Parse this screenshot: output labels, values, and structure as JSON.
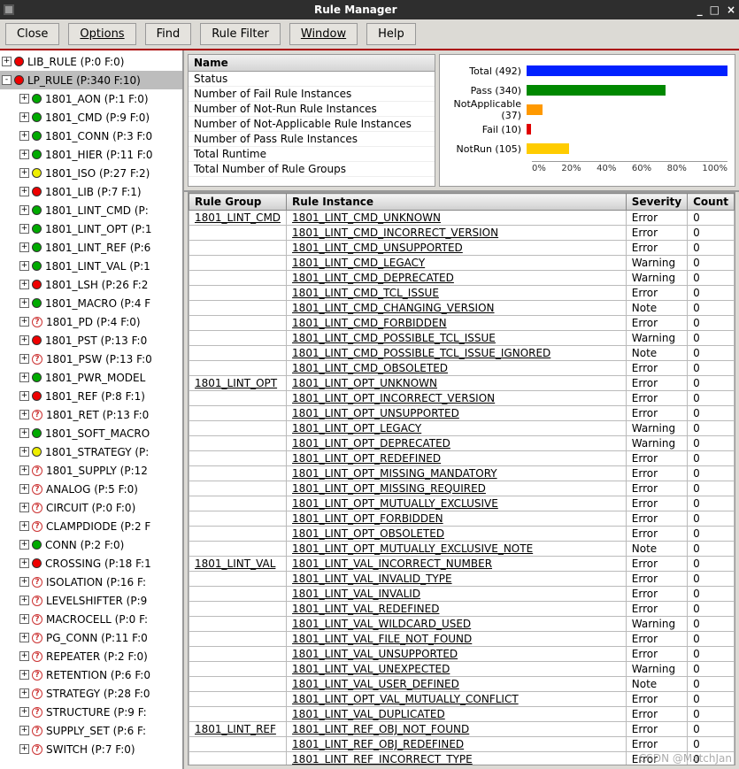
{
  "window": {
    "title": "Rule Manager",
    "min": "_",
    "max": "□",
    "close": "×"
  },
  "menu": {
    "close": "Close",
    "options": "Options",
    "find": "Find",
    "rule_filter": "Rule Filter",
    "window": "Window",
    "help": "Help"
  },
  "tree": [
    {
      "lvl": 0,
      "dot": "red",
      "label": "LIB_RULE",
      "info": "(P:0 F:0)",
      "sel": false,
      "exp": "+"
    },
    {
      "lvl": 0,
      "dot": "red",
      "label": "LP_RULE",
      "info": "(P:340 F:10)",
      "sel": true,
      "exp": "-"
    },
    {
      "lvl": 1,
      "dot": "green",
      "label": "1801_AON",
      "info": "(P:1 F:0)",
      "exp": "+"
    },
    {
      "lvl": 1,
      "dot": "green",
      "label": "1801_CMD",
      "info": "(P:9 F:0)",
      "exp": "+"
    },
    {
      "lvl": 1,
      "dot": "green",
      "label": "1801_CONN",
      "info": "(P:3 F:0",
      "exp": "+"
    },
    {
      "lvl": 1,
      "dot": "green",
      "label": "1801_HIER",
      "info": "(P:11 F:0",
      "exp": "+"
    },
    {
      "lvl": 1,
      "dot": "yellow",
      "label": "1801_ISO",
      "info": "(P:27 F:2)",
      "exp": "+"
    },
    {
      "lvl": 1,
      "dot": "red",
      "label": "1801_LIB",
      "info": "(P:7 F:1)",
      "exp": "+"
    },
    {
      "lvl": 1,
      "dot": "green",
      "label": "1801_LINT_CMD",
      "info": "(P:",
      "exp": "+"
    },
    {
      "lvl": 1,
      "dot": "green",
      "label": "1801_LINT_OPT",
      "info": "(P:1",
      "exp": "+"
    },
    {
      "lvl": 1,
      "dot": "green",
      "label": "1801_LINT_REF",
      "info": "(P:6",
      "exp": "+"
    },
    {
      "lvl": 1,
      "dot": "green",
      "label": "1801_LINT_VAL",
      "info": "(P:1",
      "exp": "+"
    },
    {
      "lvl": 1,
      "dot": "red",
      "label": "1801_LSH",
      "info": "(P:26 F:2",
      "exp": "+"
    },
    {
      "lvl": 1,
      "dot": "green",
      "label": "1801_MACRO",
      "info": "(P:4 F",
      "exp": "+"
    },
    {
      "lvl": 1,
      "dot": "q",
      "label": "1801_PD",
      "info": "(P:4 F:0)",
      "exp": "+"
    },
    {
      "lvl": 1,
      "dot": "red",
      "label": "1801_PST",
      "info": "(P:13 F:0",
      "exp": "+"
    },
    {
      "lvl": 1,
      "dot": "q",
      "label": "1801_PSW",
      "info": "(P:13 F:0",
      "exp": "+"
    },
    {
      "lvl": 1,
      "dot": "green",
      "label": "1801_PWR_MODEL",
      "info": "",
      "exp": "+"
    },
    {
      "lvl": 1,
      "dot": "red",
      "label": "1801_REF",
      "info": "(P:8 F:1)",
      "exp": "+"
    },
    {
      "lvl": 1,
      "dot": "q",
      "label": "1801_RET",
      "info": "(P:13 F:0",
      "exp": "+"
    },
    {
      "lvl": 1,
      "dot": "green",
      "label": "1801_SOFT_MACRO",
      "info": "",
      "exp": "+"
    },
    {
      "lvl": 1,
      "dot": "yellow",
      "label": "1801_STRATEGY",
      "info": "(P:",
      "exp": "+"
    },
    {
      "lvl": 1,
      "dot": "q",
      "label": "1801_SUPPLY",
      "info": "(P:12",
      "exp": "+"
    },
    {
      "lvl": 1,
      "dot": "q",
      "label": "ANALOG",
      "info": "(P:5 F:0)",
      "exp": "+"
    },
    {
      "lvl": 1,
      "dot": "q",
      "label": "CIRCUIT",
      "info": "(P:0 F:0)",
      "exp": "+"
    },
    {
      "lvl": 1,
      "dot": "q",
      "label": "CLAMPDIODE",
      "info": "(P:2 F",
      "exp": "+"
    },
    {
      "lvl": 1,
      "dot": "green",
      "label": "CONN",
      "info": "(P:2 F:0)",
      "exp": "+"
    },
    {
      "lvl": 1,
      "dot": "red",
      "label": "CROSSING",
      "info": "(P:18 F:1",
      "exp": "+"
    },
    {
      "lvl": 1,
      "dot": "q",
      "label": "ISOLATION",
      "info": "(P:16 F:",
      "exp": "+"
    },
    {
      "lvl": 1,
      "dot": "q",
      "label": "LEVELSHIFTER",
      "info": "(P:9",
      "exp": "+"
    },
    {
      "lvl": 1,
      "dot": "q",
      "label": "MACROCELL",
      "info": "(P:0 F:",
      "exp": "+"
    },
    {
      "lvl": 1,
      "dot": "q",
      "label": "PG_CONN",
      "info": "(P:11 F:0",
      "exp": "+"
    },
    {
      "lvl": 1,
      "dot": "q",
      "label": "REPEATER",
      "info": "(P:2 F:0)",
      "exp": "+"
    },
    {
      "lvl": 1,
      "dot": "q",
      "label": "RETENTION",
      "info": "(P:6 F:0",
      "exp": "+"
    },
    {
      "lvl": 1,
      "dot": "q",
      "label": "STRATEGY",
      "info": "(P:28 F:0",
      "exp": "+"
    },
    {
      "lvl": 1,
      "dot": "q",
      "label": "STRUCTURE",
      "info": "(P:9 F:",
      "exp": "+"
    },
    {
      "lvl": 1,
      "dot": "q",
      "label": "SUPPLY_SET",
      "info": "(P:6 F:",
      "exp": "+"
    },
    {
      "lvl": 1,
      "dot": "q",
      "label": "SWITCH",
      "info": "(P:7 F:0)",
      "exp": "+"
    }
  ],
  "field_list": {
    "header": "Name",
    "rows": [
      "Status",
      "Number of Fail Rule Instances",
      "Number of Not-Run Rule Instances",
      "Number of Not-Applicable Rule Instances",
      "Number of Pass Rule Instances",
      "Total Runtime",
      "Total Number of Rule Groups"
    ]
  },
  "chart_data": {
    "type": "bar",
    "orientation": "horizontal",
    "categories": [
      "Total (492)",
      "Pass (340)",
      "NotApplicable (37)",
      "Fail (10)",
      "NotRun (105)"
    ],
    "values": [
      100,
      69,
      8,
      2,
      21
    ],
    "colors": [
      "#0020ff",
      "#008800",
      "#ff9900",
      "#e00000",
      "#ffcc00"
    ],
    "axis_ticks": [
      "0%",
      "20%",
      "40%",
      "60%",
      "80%",
      "100%"
    ],
    "xlim": [
      0,
      100
    ]
  },
  "table": {
    "headers": [
      "Rule Group",
      "Rule Instance",
      "Severity",
      "Count"
    ],
    "rows": [
      {
        "g": "1801_LINT_CMD",
        "i": "1801_LINT_CMD_UNKNOWN",
        "s": "Error",
        "c": "0"
      },
      {
        "g": "",
        "i": "1801_LINT_CMD_INCORRECT_VERSION",
        "s": "Error",
        "c": "0"
      },
      {
        "g": "",
        "i": "1801_LINT_CMD_UNSUPPORTED",
        "s": "Error",
        "c": "0"
      },
      {
        "g": "",
        "i": "1801_LINT_CMD_LEGACY",
        "s": "Warning",
        "c": "0"
      },
      {
        "g": "",
        "i": "1801_LINT_CMD_DEPRECATED",
        "s": "Warning",
        "c": "0"
      },
      {
        "g": "",
        "i": "1801_LINT_CMD_TCL_ISSUE",
        "s": "Error",
        "c": "0"
      },
      {
        "g": "",
        "i": "1801_LINT_CMD_CHANGING_VERSION",
        "s": "Note",
        "c": "0"
      },
      {
        "g": "",
        "i": "1801_LINT_CMD_FORBIDDEN",
        "s": "Error",
        "c": "0"
      },
      {
        "g": "",
        "i": "1801_LINT_CMD_POSSIBLE_TCL_ISSUE",
        "s": "Warning",
        "c": "0"
      },
      {
        "g": "",
        "i": "1801_LINT_CMD_POSSIBLE_TCL_ISSUE_IGNORED",
        "s": "Note",
        "c": "0"
      },
      {
        "g": "",
        "i": "1801_LINT_CMD_OBSOLETED",
        "s": "Error",
        "c": "0"
      },
      {
        "g": "1801_LINT_OPT",
        "i": "1801_LINT_OPT_UNKNOWN",
        "s": "Error",
        "c": "0"
      },
      {
        "g": "",
        "i": "1801_LINT_OPT_INCORRECT_VERSION",
        "s": "Error",
        "c": "0"
      },
      {
        "g": "",
        "i": "1801_LINT_OPT_UNSUPPORTED",
        "s": "Error",
        "c": "0"
      },
      {
        "g": "",
        "i": "1801_LINT_OPT_LEGACY",
        "s": "Warning",
        "c": "0"
      },
      {
        "g": "",
        "i": "1801_LINT_OPT_DEPRECATED",
        "s": "Warning",
        "c": "0"
      },
      {
        "g": "",
        "i": "1801_LINT_OPT_REDEFINED",
        "s": "Error",
        "c": "0"
      },
      {
        "g": "",
        "i": "1801_LINT_OPT_MISSING_MANDATORY",
        "s": "Error",
        "c": "0"
      },
      {
        "g": "",
        "i": "1801_LINT_OPT_MISSING_REQUIRED",
        "s": "Error",
        "c": "0"
      },
      {
        "g": "",
        "i": "1801_LINT_OPT_MUTUALLY_EXCLUSIVE",
        "s": "Error",
        "c": "0"
      },
      {
        "g": "",
        "i": "1801_LINT_OPT_FORBIDDEN",
        "s": "Error",
        "c": "0"
      },
      {
        "g": "",
        "i": "1801_LINT_OPT_OBSOLETED",
        "s": "Error",
        "c": "0"
      },
      {
        "g": "",
        "i": "1801_LINT_OPT_MUTUALLY_EXCLUSIVE_NOTE",
        "s": "Note",
        "c": "0"
      },
      {
        "g": "1801_LINT_VAL",
        "i": "1801_LINT_VAL_INCORRECT_NUMBER",
        "s": "Error",
        "c": "0"
      },
      {
        "g": "",
        "i": "1801_LINT_VAL_INVALID_TYPE",
        "s": "Error",
        "c": "0"
      },
      {
        "g": "",
        "i": "1801_LINT_VAL_INVALID",
        "s": "Error",
        "c": "0"
      },
      {
        "g": "",
        "i": "1801_LINT_VAL_REDEFINED",
        "s": "Error",
        "c": "0"
      },
      {
        "g": "",
        "i": "1801_LINT_VAL_WILDCARD_USED",
        "s": "Warning",
        "c": "0"
      },
      {
        "g": "",
        "i": "1801_LINT_VAL_FILE_NOT_FOUND",
        "s": "Error",
        "c": "0"
      },
      {
        "g": "",
        "i": "1801_LINT_VAL_UNSUPPORTED",
        "s": "Error",
        "c": "0"
      },
      {
        "g": "",
        "i": "1801_LINT_VAL_UNEXPECTED",
        "s": "Warning",
        "c": "0"
      },
      {
        "g": "",
        "i": "1801_LINT_VAL_USER_DEFINED",
        "s": "Note",
        "c": "0"
      },
      {
        "g": "",
        "i": "1801_LINT_OPT_VAL_MUTUALLY_CONFLICT",
        "s": "Error",
        "c": "0"
      },
      {
        "g": "",
        "i": "1801_LINT_VAL_DUPLICATED",
        "s": "Error",
        "c": "0"
      },
      {
        "g": "1801_LINT_REF",
        "i": "1801_LINT_REF_OBJ_NOT_FOUND",
        "s": "Error",
        "c": "0"
      },
      {
        "g": "",
        "i": "1801_LINT_REF_OBJ_REDEFINED",
        "s": "Error",
        "c": "0"
      },
      {
        "g": "",
        "i": "1801_LINT_REF_INCORRECT_TYPE",
        "s": "Error",
        "c": "0"
      }
    ]
  },
  "watermark": "CSDN @MatchJan"
}
